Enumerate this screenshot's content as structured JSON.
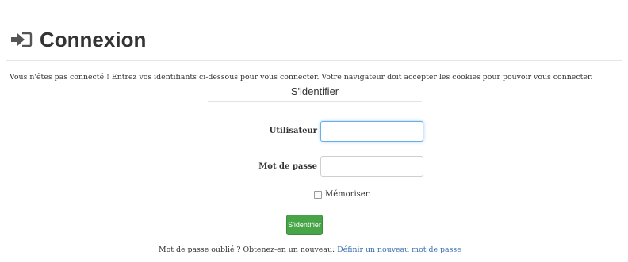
{
  "page": {
    "title": "Connexion",
    "intro": "Vous n'êtes pas connecté ! Entrez vos identifiants ci-dessous pour vous connecter. Votre navigateur doit accepter les cookies pour pouvoir vous connecter."
  },
  "form": {
    "title": "S'identifier",
    "username_label": "Utilisateur",
    "username_value": "",
    "password_label": "Mot de passe",
    "password_value": "",
    "remember_label": "Mémoriser",
    "remember_checked": false,
    "submit_label": "S'identifier"
  },
  "forgot": {
    "text": "Mot de passe oublié ? Obtenez-en un nouveau:",
    "link": "Définir un nouveau mot de passe"
  },
  "colors": {
    "primary_button": "#47a447",
    "link": "#3a6fb0",
    "focus": "#66afe9"
  },
  "icons": [
    "sign-in-arrow-icon"
  ]
}
